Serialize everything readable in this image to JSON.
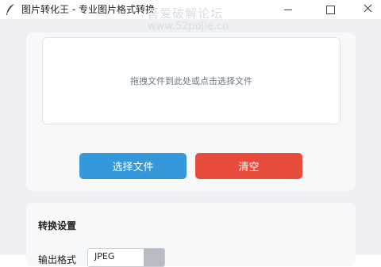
{
  "window": {
    "title": "图片转化王 - 专业图片格式转换",
    "icon": "feather-icon",
    "controls": [
      "minimize-icon",
      "maximize-icon",
      "close-icon"
    ]
  },
  "watermark": {
    "text": "吾爱破解论坛",
    "url": "www.52pojie.cn"
  },
  "upload": {
    "dropzone_text": "拖拽文件到此处或点击选择文件",
    "select_label": "选择文件",
    "clear_label": "清空"
  },
  "settings": {
    "title": "转换设置",
    "format_label": "输出格式",
    "format_value": "JPEG"
  },
  "colors": {
    "select_button": "#3498db",
    "clear_button": "#e74c3c",
    "background": "#eef0f3"
  }
}
